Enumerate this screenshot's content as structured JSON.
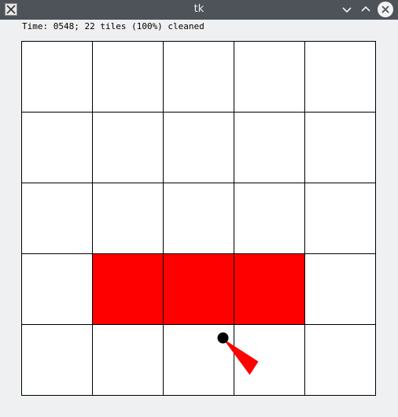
{
  "window": {
    "title": "tk",
    "app_icon": "x-icon",
    "controls": [
      "minimize-icon",
      "maximize-icon",
      "close-icon"
    ]
  },
  "status": {
    "text": "Time: 0548; 22 tiles (100%) cleaned"
  },
  "grid": {
    "cols": 5,
    "rows": 5,
    "dirty_color": "#ff0000",
    "clean_color": "#ffffff",
    "line_color": "#000000",
    "dirty_tiles": [
      {
        "col": 1,
        "row": 3
      },
      {
        "col": 2,
        "row": 3
      },
      {
        "col": 3,
        "row": 3
      }
    ]
  },
  "robot": {
    "body_color": "#000000",
    "heading_color": "#ff0000"
  }
}
